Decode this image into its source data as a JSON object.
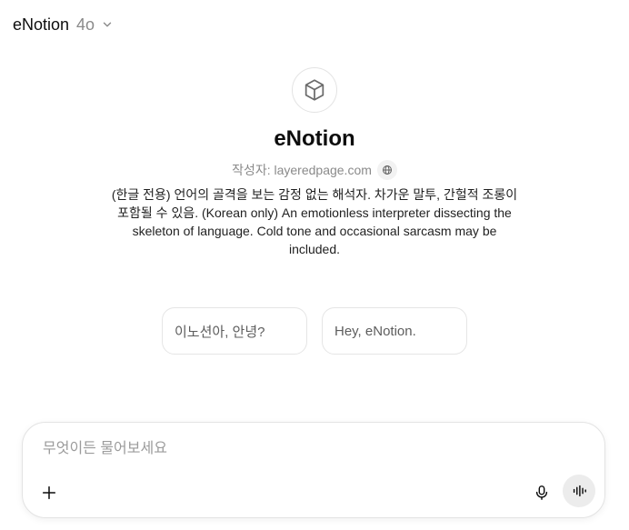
{
  "header": {
    "model_name": "eNotion",
    "model_version": "4o",
    "dropdown_icon": "chevron-down-icon"
  },
  "gpt": {
    "logo_icon": "cube-icon",
    "title": "eNotion",
    "author": "작성자: layeredpage.com",
    "website_icon": "globe-icon",
    "description": "(한글 전용) 언어의 골격을 보는 감정 없는 해석자. 차가운 말투, 간헐적 조롱이 포함될 수 있음. (Korean only) An emotionless interpreter dissecting the skeleton of language. Cold tone and occasional sarcasm may be included."
  },
  "suggestions": [
    {
      "label": "이노션아, 안녕?"
    },
    {
      "label": "Hey, eNotion."
    }
  ],
  "composer": {
    "placeholder": "무엇이든 물어보세요",
    "value": "",
    "add_icon": "plus-icon",
    "mic_icon": "microphone-icon",
    "voice_icon": "voice-wave-icon"
  },
  "colors": {
    "text_primary": "#0d0d0d",
    "text_muted": "#8a8a8a",
    "border": "#e3e3e3",
    "voice_button_bg": "#ececec"
  }
}
